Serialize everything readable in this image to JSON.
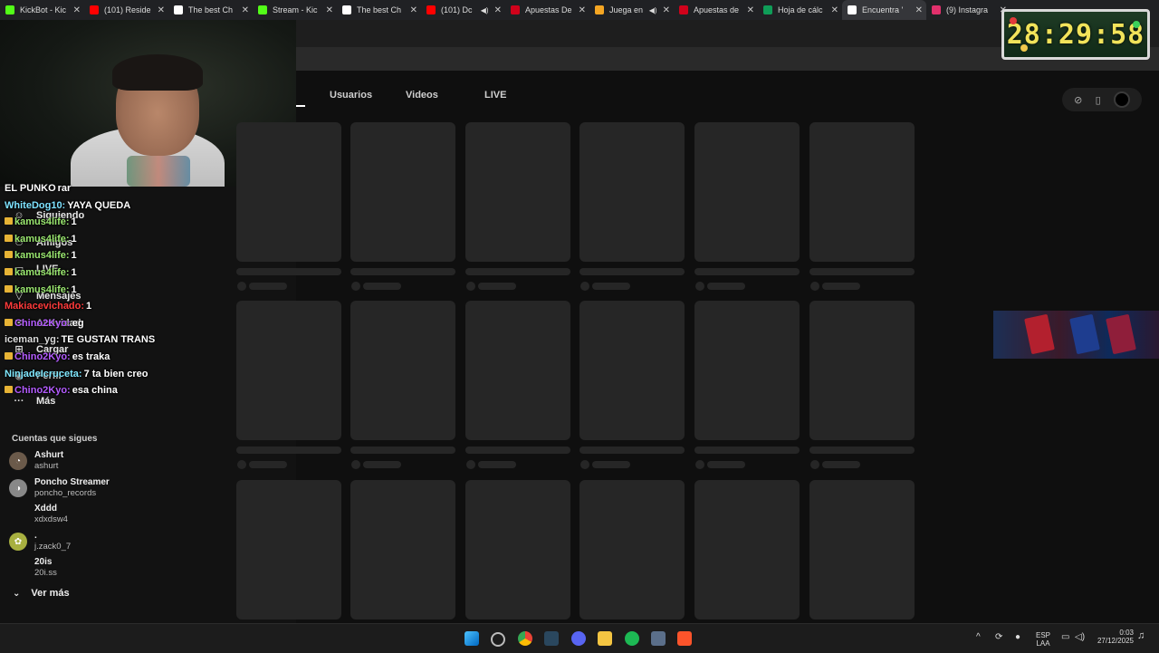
{
  "browser": {
    "tabs": [
      {
        "title": "KickBot - Kic",
        "favicon_color": "#53fc18",
        "active": false,
        "audio": false
      },
      {
        "title": "(101) Reside",
        "favicon_color": "#ff0000",
        "active": false,
        "audio": false
      },
      {
        "title": "The best Ch",
        "favicon_color": "#ffffff",
        "active": false,
        "audio": false
      },
      {
        "title": "Stream - Kic",
        "favicon_color": "#53fc18",
        "active": false,
        "audio": false
      },
      {
        "title": "The best Ch",
        "favicon_color": "#ffffff",
        "active": false,
        "audio": false
      },
      {
        "title": "(101) Dc",
        "favicon_color": "#ff0000",
        "active": false,
        "audio": true
      },
      {
        "title": "Apuestas De",
        "favicon_color": "#d0021b",
        "active": false,
        "audio": false
      },
      {
        "title": "Juega en",
        "favicon_color": "#f5a623",
        "active": false,
        "audio": true
      },
      {
        "title": "Apuestas de",
        "favicon_color": "#d0021b",
        "active": false,
        "audio": false
      },
      {
        "title": "Hoja de cálc",
        "favicon_color": "#0f9d58",
        "active": false,
        "audio": false
      },
      {
        "title": "Encuentra '",
        "favicon_color": "#ffffff",
        "active": true,
        "audio": false
      },
      {
        "title": "(9) Instagra",
        "favicon_color": "#e1306c",
        "active": false,
        "audio": false
      }
    ]
  },
  "timer": {
    "value": "28:29:58"
  },
  "sidebar": {
    "nav": [
      {
        "label": "Siguiendo",
        "icon": "following-icon"
      },
      {
        "label": "Amigos",
        "icon": "friends-icon"
      },
      {
        "label": "LIVE",
        "icon": "live-icon"
      },
      {
        "label": "Mensajes",
        "icon": "messages-icon"
      },
      {
        "label": "Actividad",
        "icon": "activity-icon"
      },
      {
        "label": "Cargar",
        "icon": "upload-icon"
      },
      {
        "label": "Perfil",
        "icon": "profile-icon"
      },
      {
        "label": "Más",
        "icon": "more-icon"
      }
    ],
    "following_title": "Cuentas que sigues",
    "accounts": [
      {
        "name": "Ashurt",
        "handle": "ashurt"
      },
      {
        "name": "Poncho Streamer",
        "handle": "poncho_records"
      },
      {
        "name": "Xddd",
        "handle": "xdxdsw4"
      },
      {
        "name": ".",
        "handle": "j.zack0_7"
      },
      {
        "name": "20is",
        "handle": "20i.ss"
      }
    ],
    "see_more": "Ver más"
  },
  "chat": [
    {
      "user": "EL PUNKO",
      "message": "rar",
      "color": "#ffffff",
      "crown": false
    },
    {
      "user": "WhiteDog10:",
      "message": "YAYA QUEDA",
      "color": "#7ee2ff",
      "crown": false
    },
    {
      "user": "kamus4life:",
      "message": "1",
      "color": "#9be870",
      "crown": true
    },
    {
      "user": "kamus4life:",
      "message": "1",
      "color": "#9be870",
      "crown": true
    },
    {
      "user": "kamus4life:",
      "message": "1",
      "color": "#9be870",
      "crown": true
    },
    {
      "user": "kamus4life:",
      "message": "1",
      "color": "#9be870",
      "crown": true
    },
    {
      "user": "kamus4life:",
      "message": "1",
      "color": "#9be870",
      "crown": true
    },
    {
      "user": "Makiacevichado:",
      "message": "1",
      "color": "#ff3b3b",
      "crown": false
    },
    {
      "user": "Chino2Kyo:",
      "message": "eg",
      "color": "#b45cff",
      "crown": true
    },
    {
      "user": "iceman_yg:",
      "message": "TE GUSTAN TRANS",
      "color": "#dcdcdc",
      "crown": false
    },
    {
      "user": "Chino2Kyo:",
      "message": "es traka",
      "color": "#b45cff",
      "crown": true
    },
    {
      "user": "NinjadeIcruceta:",
      "message": "7 ta bien creo",
      "color": "#80e8ff",
      "crown": false
    },
    {
      "user": "Chino2Kyo:",
      "message": "esa china",
      "color": "#b45cff",
      "crown": true
    }
  ],
  "search_tabs": [
    {
      "label": "Usuarios"
    },
    {
      "label": "Videos"
    },
    {
      "label": "LIVE"
    }
  ],
  "taskbar": {
    "language": "ESP",
    "layout": "LAA",
    "time": "0:03",
    "date": "27/12/2025"
  }
}
